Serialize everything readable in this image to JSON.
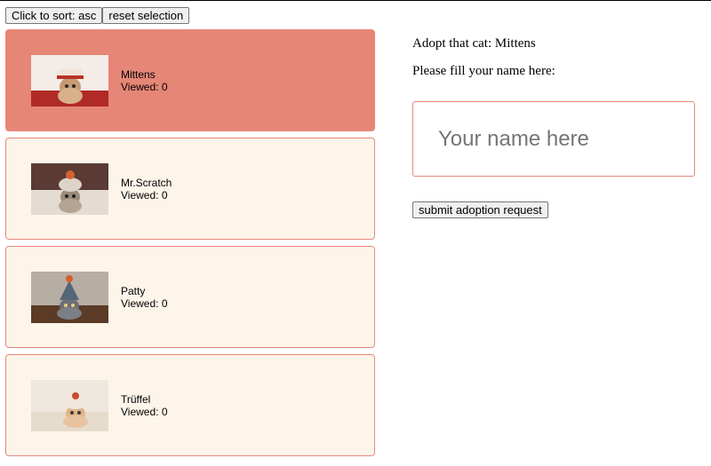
{
  "toolbar": {
    "sort_label": "Click to sort: asc",
    "reset_label": "reset selection"
  },
  "cats": [
    {
      "name": "Mittens",
      "viewed_label": "Viewed:",
      "viewed": 0,
      "selected": true
    },
    {
      "name": "Mr.Scratch",
      "viewed_label": "Viewed:",
      "viewed": 0,
      "selected": false
    },
    {
      "name": "Patty",
      "viewed_label": "Viewed:",
      "viewed": 0,
      "selected": false
    },
    {
      "name": "Trüffel",
      "viewed_label": "Viewed:",
      "viewed": 0,
      "selected": false
    }
  ],
  "adoption": {
    "heading_prefix": "Adopt that cat:",
    "selected_cat": "Mittens",
    "prompt": "Please fill your name here:",
    "name_value": "",
    "name_placeholder": "Your name here",
    "submit_label": "submit adoption request"
  },
  "colors": {
    "selected_card": "#e68677",
    "card_bg": "#fdf5ea",
    "card_border": "#e8877a"
  }
}
